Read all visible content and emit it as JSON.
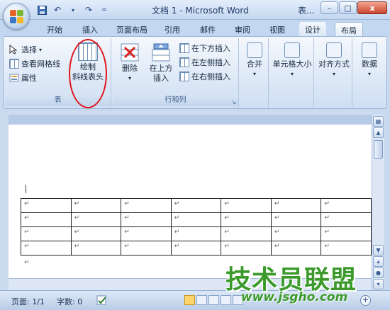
{
  "window": {
    "title": "文档 1 - Microsoft Word",
    "title_extra": "表...",
    "minimize": "–",
    "restore": "□",
    "close": "x"
  },
  "qat": {
    "save_icon": "save-icon",
    "undo_icon": "undo-icon",
    "redo_icon": "redo-icon"
  },
  "tabs": [
    {
      "label": "开始"
    },
    {
      "label": "插入"
    },
    {
      "label": "页面布局"
    },
    {
      "label": "引用"
    },
    {
      "label": "邮件"
    },
    {
      "label": "审阅"
    },
    {
      "label": "视图"
    },
    {
      "label": "设计"
    },
    {
      "label": "布局"
    }
  ],
  "ribbon": {
    "table_group": {
      "label": "表",
      "select": "选择",
      "view_gridlines": "查看网格线",
      "properties": "属性",
      "draw_diag_line1": "绘制",
      "draw_diag_line2": "斜线表头"
    },
    "rows_cols_group": {
      "label": "行和列",
      "delete": "删除",
      "insert_above_line1": "在上方",
      "insert_above_line2": "插入",
      "insert_below": "在下方插入",
      "insert_left": "在左侧插入",
      "insert_right": "在右侧插入"
    },
    "merge": "合并",
    "cell_size": "单元格大小",
    "alignment": "对齐方式",
    "data": "数据"
  },
  "document": {
    "cell_mark": "↵",
    "rows": 4,
    "cols": 7,
    "para_mark": "↵"
  },
  "status": {
    "page": "页面: 1/1",
    "words": "字数: 0"
  },
  "watermark": {
    "title": "技术员联盟",
    "url": "www.jsgho.com"
  },
  "colors": {
    "accent": "#c4d7f0",
    "highlight_circle": "#e0151a",
    "watermark": "#3b9a2b"
  }
}
